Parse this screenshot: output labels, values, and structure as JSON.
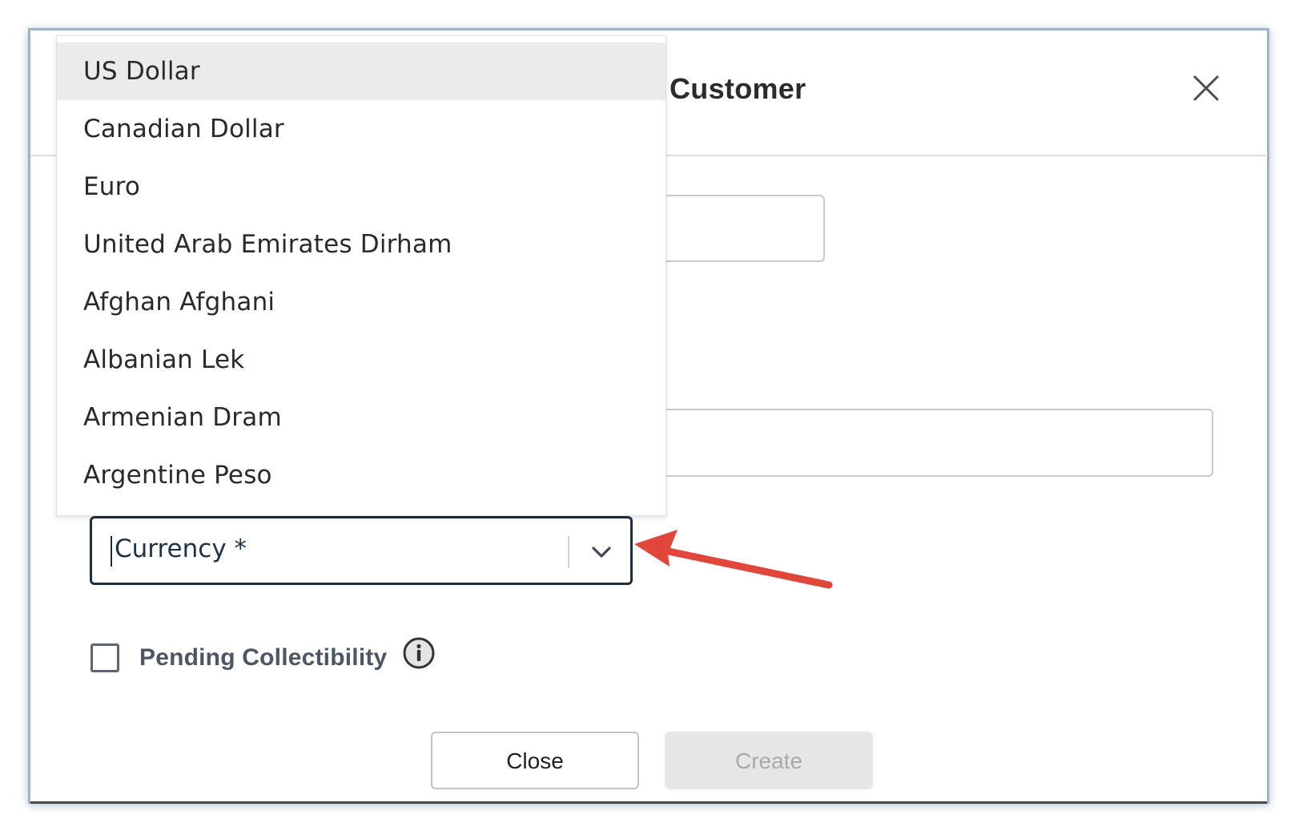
{
  "dialog": {
    "title": "Customer",
    "close_icon": "close-icon"
  },
  "currency_dropdown": {
    "options": [
      "US Dollar",
      "Canadian Dollar",
      "Euro",
      "United Arab Emirates Dirham",
      "Afghan Afghani",
      "Albanian Lek",
      "Armenian Dram",
      "Argentine Peso"
    ],
    "highlighted_option": "US Dollar"
  },
  "currency_field": {
    "placeholder": "Currency *",
    "chevron_icon": "chevron-down-icon"
  },
  "annotation": {
    "arrow_color": "#e0463a"
  },
  "pending_collectibility": {
    "label": "Pending Collectibility",
    "checked": false,
    "info_icon": "info-icon"
  },
  "footer": {
    "close_label": "Close",
    "create_label": "Create"
  },
  "colors": {
    "dialog_border": "#9bb3c9",
    "focused_border": "#1f2d3d",
    "highlight_bg": "#ebebeb",
    "disabled_button_bg": "#e6e6e6"
  }
}
